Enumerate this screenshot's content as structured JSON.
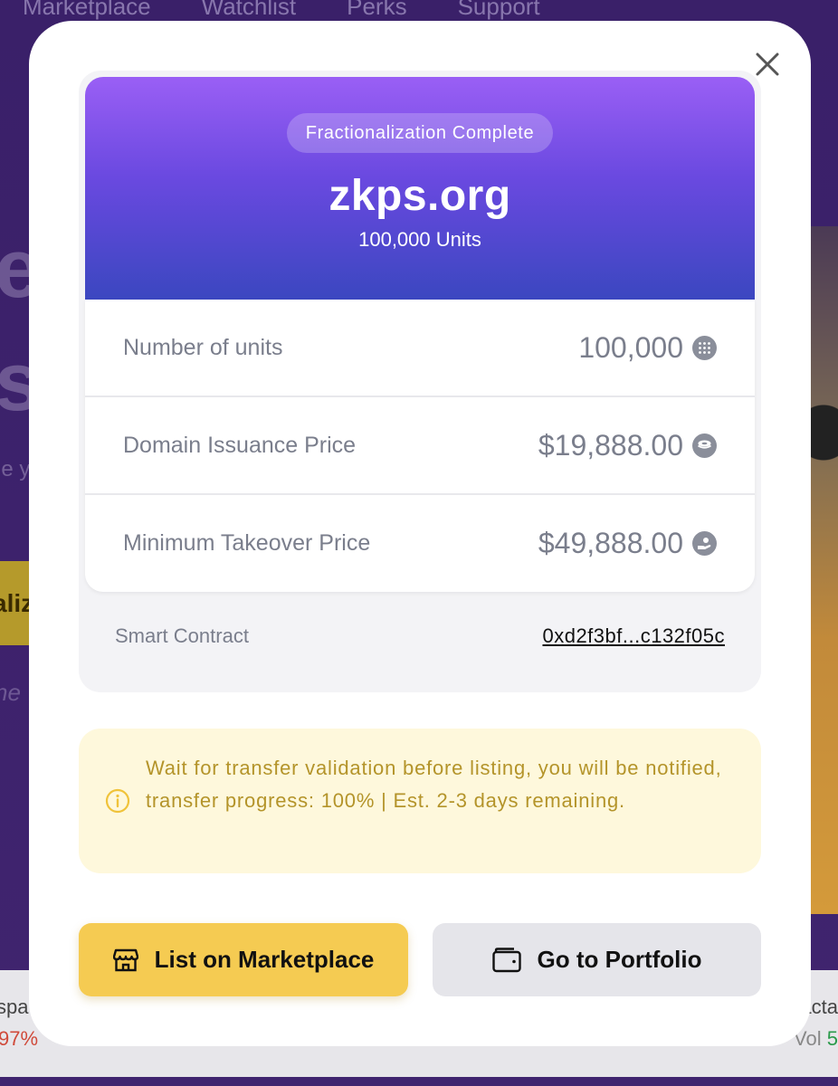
{
  "background": {
    "nav": [
      "Marketplace",
      "Watchlist",
      "Perks",
      "Support"
    ],
    "hero_letters": [
      "e",
      "s"
    ],
    "hero_sub": "le y",
    "button_fragment": "aliz",
    "italic_fragment": "ne",
    "ticker_left": {
      "name": "spa",
      "change": "97%"
    },
    "ticker_right": {
      "name": "acta",
      "vol_label": "Vol",
      "vol_value": "5"
    }
  },
  "modal": {
    "close_icon": "close-icon",
    "badge": "Fractionalization Complete",
    "domain": "zkps.org",
    "units_subtitle": "100,000 Units",
    "rows": [
      {
        "label": "Number of units",
        "value": "100,000",
        "icon": "grid-dots-icon"
      },
      {
        "label": "Domain Issuance Price",
        "value": "$19,888.00",
        "icon": "coin-stack-icon"
      },
      {
        "label": "Minimum Takeover Price",
        "value": "$49,888.00",
        "icon": "hand-coin-icon"
      }
    ],
    "contract": {
      "label": "Smart Contract",
      "address": "0xd2f3bf...c132f05c"
    },
    "notice": {
      "icon": "info-icon",
      "text": "Wait for transfer validation before listing, you will be notified, transfer progress: 100% | Est. 2-3 days remaining."
    },
    "buttons": {
      "list": {
        "label": "List on Marketplace",
        "icon": "store-icon"
      },
      "portfolio": {
        "label": "Go to Portfolio",
        "icon": "wallet-icon"
      }
    }
  },
  "colors": {
    "header_top": "#9a5ff5",
    "header_bottom": "#3b47c0",
    "primary_button": "#f5cb52",
    "notice_bg": "#fef8dc",
    "notice_text": "#b4942a"
  }
}
